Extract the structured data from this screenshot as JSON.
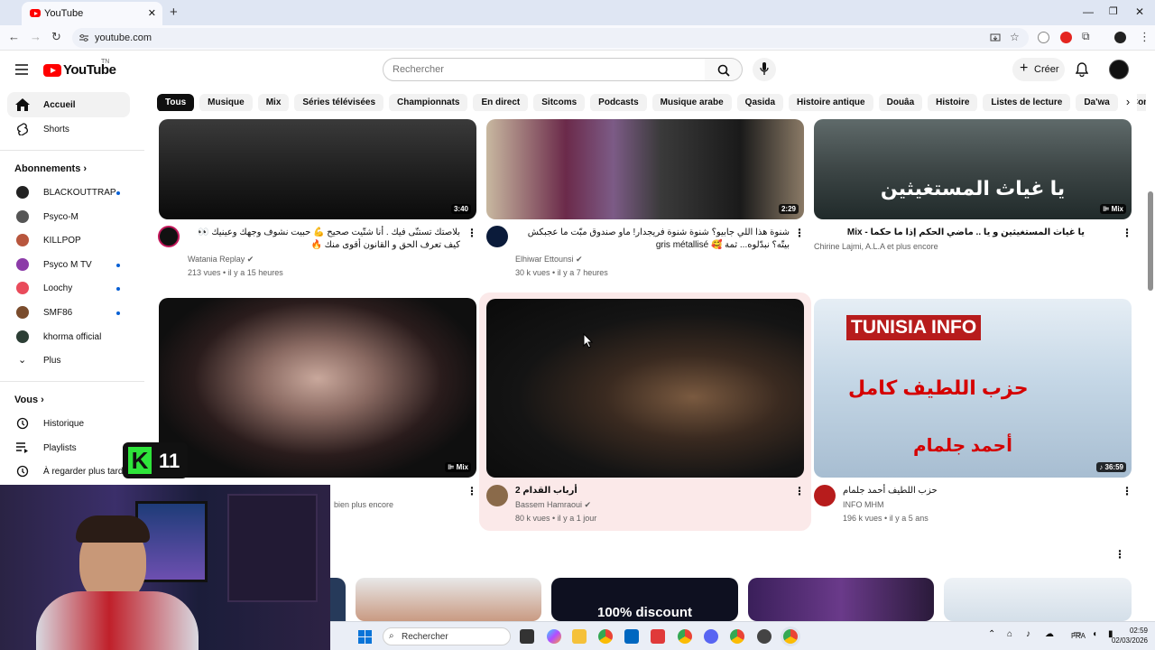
{
  "browser": {
    "tab_title": "YouTube",
    "url": "youtube.com"
  },
  "header": {
    "logo_text": "YouTube",
    "logo_region": "TN",
    "search_placeholder": "Rechercher",
    "create_label": "Créer"
  },
  "chips": [
    "Tous",
    "Musique",
    "Mix",
    "Séries télévisées",
    "Championnats",
    "En direct",
    "Sitcoms",
    "Podcasts",
    "Musique arabe",
    "Qasida",
    "Histoire antique",
    "Douâa",
    "Histoire",
    "Listes de lecture",
    "Da'wa",
    "Comédie à sketch"
  ],
  "sidebar": {
    "home": "Accueil",
    "shorts": "Shorts",
    "subscriptions_heading": "Abonnements",
    "subscriptions": [
      {
        "name": "BLACKOUTTRAP",
        "new": true
      },
      {
        "name": "Psyco-M",
        "new": false
      },
      {
        "name": "KILLPOP",
        "new": false
      },
      {
        "name": "Psyco M TV",
        "new": true
      },
      {
        "name": "Loochy",
        "new": true
      },
      {
        "name": "SMF86",
        "new": true
      },
      {
        "name": "khorma official",
        "new": false
      }
    ],
    "more": "Plus",
    "you_heading": "Vous",
    "history": "Historique",
    "playlists": "Playlists",
    "watch_later": "À regarder plus tard"
  },
  "videos": [
    {
      "duration": "3:40",
      "title": "بلاصتك تستنّى فيك . أنا شتّيت صحيح 💪 حبيت نشوف وجهك وعينيك 👀 كيف تعرف الحق و القانون أقوى منك 🔥",
      "channel": "Watania Replay",
      "verified": true,
      "views": "213 vues",
      "age": "il y a 15 heures"
    },
    {
      "duration": "2:29",
      "title": "شنوة هذا اللي جابيو؟ شنوة شنوة فريجدار! ماو صندوق مبّت ما عجبكش بيتّه؟ نبدّلوه... ثمة 🥰 gris métallisé",
      "channel": "Elhiwar Ettounsi",
      "verified": true,
      "views": "30 k vues",
      "age": "il y a 7 heures"
    },
    {
      "duration": "Mix",
      "title": "يا غياث المستغيثين و يا .. ماضي الحكم إذا ما حكما - Mix",
      "channel": "Chirine Lajmi, A.L.A et plus encore",
      "verified": false,
      "views": "",
      "age": ""
    },
    {
      "duration": "Mix",
      "title": "",
      "channel": "bien plus encore",
      "verified": false,
      "views": "",
      "age": ""
    },
    {
      "duration": "",
      "title": "أرباب القدام 2",
      "channel": "Bassem Hamraoui",
      "verified": true,
      "views": "80 k vues",
      "age": "il y a 1 jour"
    },
    {
      "duration": "36:59",
      "title": "حزب اللطيف أحمد جلمام",
      "channel": "INFO MHM",
      "verified": false,
      "views": "196 k vues",
      "age": "il y a 5 ans"
    }
  ],
  "thumb_text": {
    "v3": "يا غياث المستغيثين",
    "v6_top": "TUNISIA INFO",
    "v6_mid": "حزب اللطيف كامل",
    "v6_bot": "أحمد جلمام",
    "row3_b": "100% discount"
  },
  "overlay": {
    "brand_letter": "K",
    "brand_number": "11"
  },
  "taskbar": {
    "search_placeholder": "Rechercher",
    "language": "FRA",
    "time": "02:59",
    "date": "02/03/2026"
  }
}
